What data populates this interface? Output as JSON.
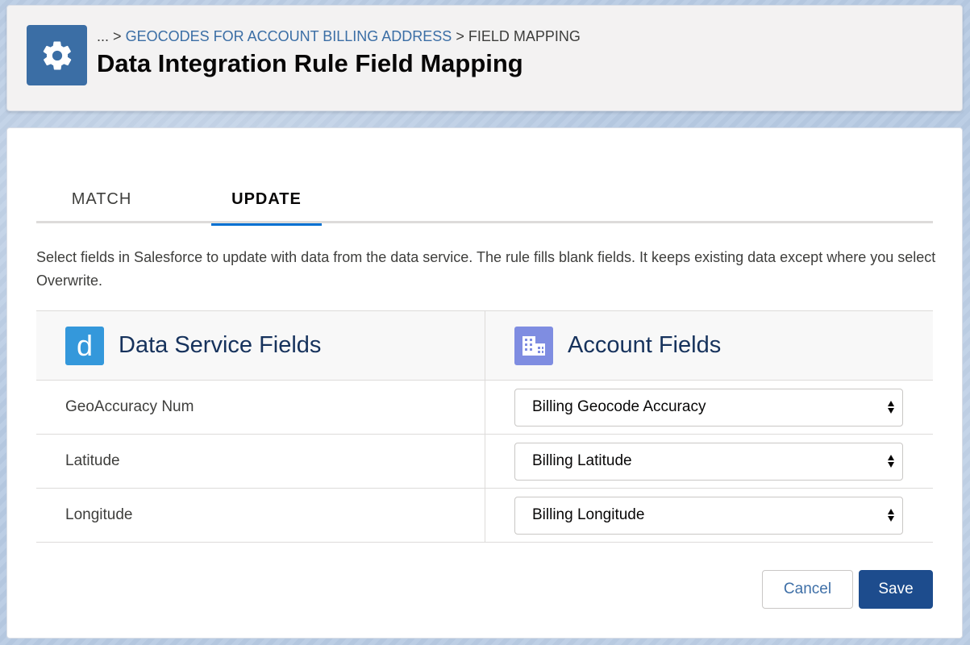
{
  "header": {
    "icon": "gear-icon",
    "breadcrumb": {
      "ellipsis": "...",
      "separator": ">",
      "parent": "GEOCODES FOR ACCOUNT BILLING ADDRESS",
      "current": "FIELD MAPPING"
    },
    "title": "Data Integration Rule Field Mapping"
  },
  "tabs": [
    {
      "label": "MATCH",
      "active": false
    },
    {
      "label": "UPDATE",
      "active": true
    }
  ],
  "description": "Select fields in Salesforce to update with data from the data service. The rule fills blank fields. It keeps existing data except where you select Overwrite.",
  "table": {
    "left_header": {
      "icon_letter": "d",
      "icon": "data-service-icon",
      "label": "Data Service Fields"
    },
    "right_header": {
      "icon": "building-icon",
      "label": "Account Fields"
    },
    "rows": [
      {
        "source": "GeoAccuracy Num",
        "target": "Billing Geocode Accuracy"
      },
      {
        "source": "Latitude",
        "target": "Billing Latitude"
      },
      {
        "source": "Longitude",
        "target": "Billing Longitude"
      }
    ]
  },
  "buttons": {
    "cancel": "Cancel",
    "save": "Save"
  },
  "colors": {
    "header_icon_bg": "#3b6ea5",
    "breadcrumb_link": "#3b6ea5",
    "tab_active_underline": "#0070d2",
    "data_service_icon_bg": "#3498db",
    "account_icon_bg": "#7f8de1",
    "save_button_bg": "#1d4c8d"
  }
}
